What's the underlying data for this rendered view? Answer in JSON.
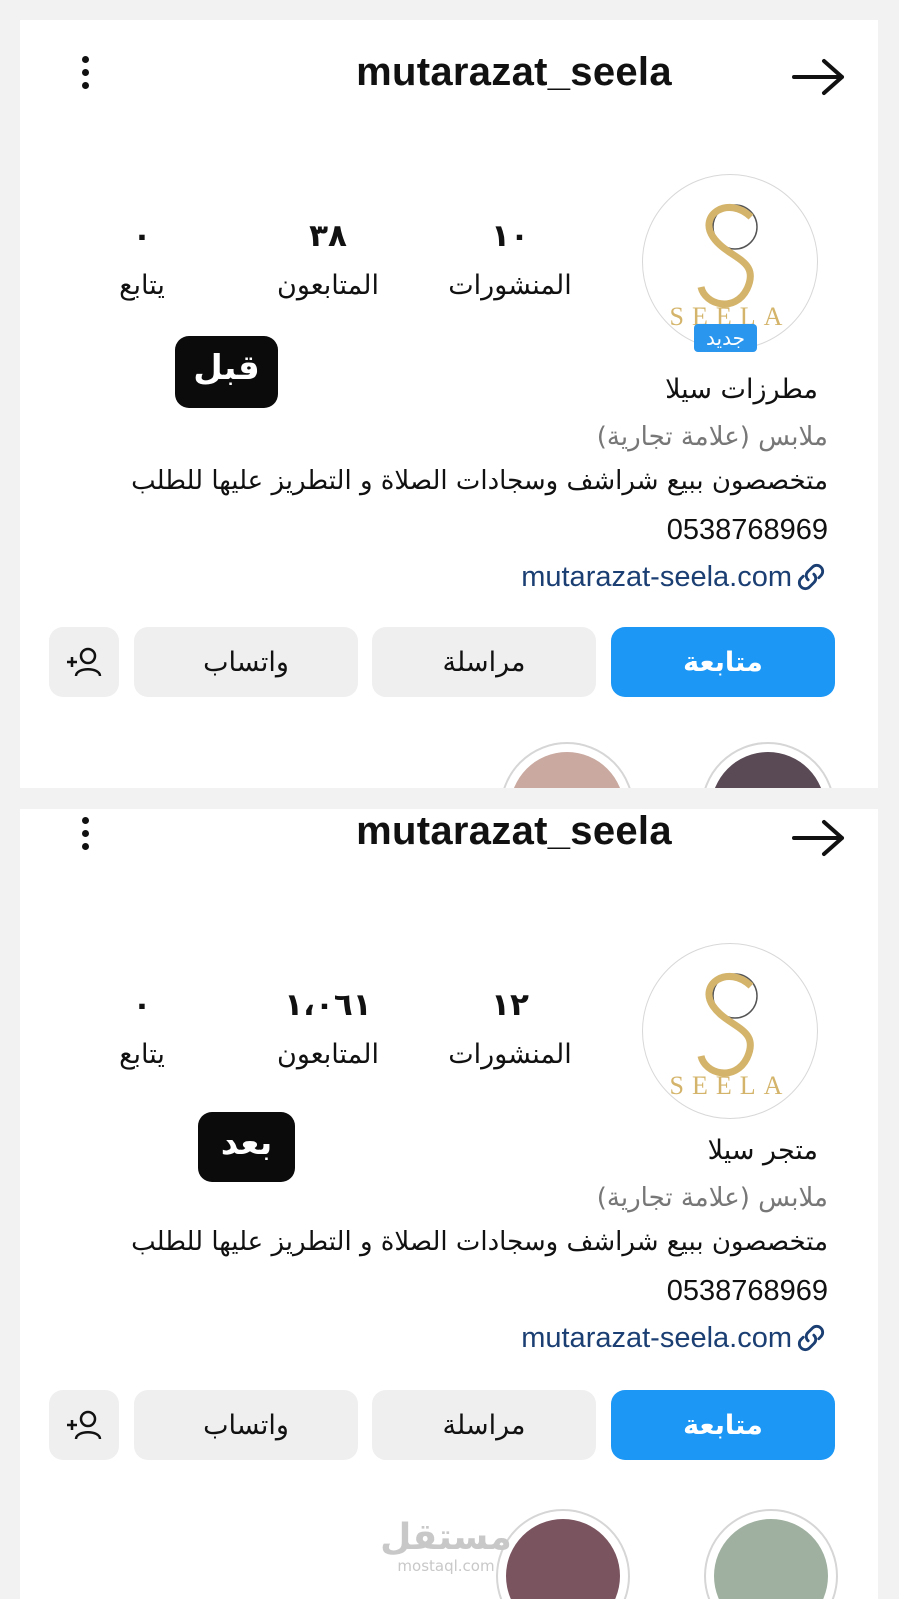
{
  "before": {
    "username": "mutarazat_seela",
    "stats": [
      {
        "value": "١٠",
        "label": "المنشورات"
      },
      {
        "value": "٣٨",
        "label": "المتابعون"
      },
      {
        "value": "٠",
        "label": "يتابع"
      }
    ],
    "avatar_text": "SEELA",
    "badge_new": "جديد",
    "tag": "قبل",
    "display_name": "مطرزات سيلا",
    "category": "ملابس (علامة تجارية)",
    "bio": "متخصصون ببيع شراشف وسجادات الصلاة و التطريز عليها للطلب",
    "phone": "0538768969",
    "website": "mutarazat-seela.com",
    "buttons": {
      "follow": "متابعة",
      "message": "مراسلة",
      "whatsapp": "واتساب"
    }
  },
  "after": {
    "username": "mutarazat_seela",
    "stats": [
      {
        "value": "١٢",
        "label": "المنشورات"
      },
      {
        "value": "١،٠٦١",
        "label": "المتابعون"
      },
      {
        "value": "٠",
        "label": "يتابع"
      }
    ],
    "avatar_text": "SEELA",
    "tag": "بعد",
    "display_name": "متجر سيلا",
    "category": "ملابس (علامة تجارية)",
    "bio": "متخصصون ببيع شراشف وسجادات الصلاة و التطريز عليها للطلب",
    "phone": "0538768969",
    "website": "mutarazat-seela.com",
    "buttons": {
      "follow": "متابعة",
      "message": "مراسلة",
      "whatsapp": "واتساب"
    }
  },
  "watermark": {
    "logo_text": "مستقل",
    "url": "mostaql.com"
  },
  "colors": {
    "follow_blue": "#1c97f5",
    "link_blue": "#1b3f73",
    "badge_blue": "#2a96ee",
    "logo_gold": "#d4b46a"
  },
  "icons": [
    "back-arrow-icon",
    "more-vertical-icon",
    "link-icon",
    "add-person-icon"
  ]
}
